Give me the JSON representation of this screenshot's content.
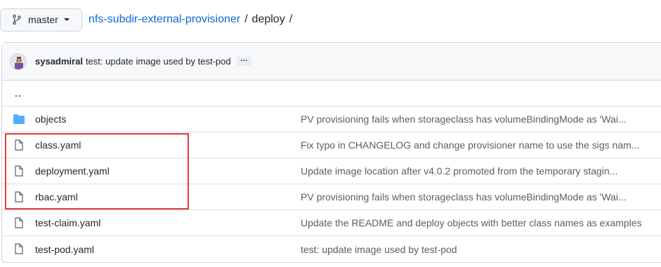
{
  "branch": {
    "label": "master",
    "icon": "git-branch-icon"
  },
  "breadcrumb": {
    "repo": "nfs-subdir-external-provisioner",
    "sep1": "/",
    "current": "deploy",
    "sep2": "/"
  },
  "commit": {
    "author": "sysadmiral",
    "message": "test: update image used by test-pod",
    "more": "…"
  },
  "parent_link": "..",
  "files": [
    {
      "type": "dir",
      "name": "objects",
      "message": "PV provisioning fails when storageclass has volumeBindingMode as 'Wai..."
    },
    {
      "type": "file",
      "name": "class.yaml",
      "message": "Fix typo in CHANGELOG and change provisioner name to use the sigs nam..."
    },
    {
      "type": "file",
      "name": "deployment.yaml",
      "message": "Update image location after v4.0.2 promoted from the temporary stagin..."
    },
    {
      "type": "file",
      "name": "rbac.yaml",
      "message": "PV provisioning fails when storageclass has volumeBindingMode as 'Wai..."
    },
    {
      "type": "file",
      "name": "test-claim.yaml",
      "message": "Update the README and deploy objects with better class names as examples"
    },
    {
      "type": "file",
      "name": "test-pod.yaml",
      "message": "test: update image used by test-pod"
    }
  ],
  "colors": {
    "link": "#0969da",
    "folder": "#54aeff",
    "highlight": "#e03b3b"
  }
}
